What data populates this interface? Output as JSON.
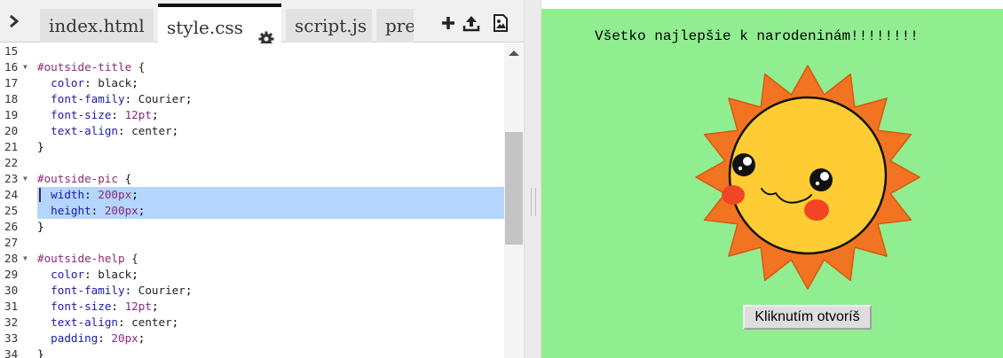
{
  "tabs": [
    {
      "label": "index.html",
      "active": false
    },
    {
      "label": "style.css",
      "active": true
    },
    {
      "label": "script.js",
      "active": false
    },
    {
      "label": "pre",
      "active": false
    }
  ],
  "toolbar": {
    "expand_icon": "chevron-right-icon",
    "settings_icon": "gear-icon",
    "add_icon": "plus-icon",
    "upload_icon": "upload-icon",
    "image_icon": "image-icon"
  },
  "code_lines": [
    {
      "num": "15",
      "text": ""
    },
    {
      "num": "16",
      "text": "#outside-title {"
    },
    {
      "num": "17",
      "text": "  color: black;"
    },
    {
      "num": "18",
      "text": "  font-family: Courier;"
    },
    {
      "num": "19",
      "text": "  font-size: 12pt;"
    },
    {
      "num": "20",
      "text": "  text-align: center;"
    },
    {
      "num": "21",
      "text": "}"
    },
    {
      "num": "22",
      "text": ""
    },
    {
      "num": "23",
      "text": "#outside-pic {"
    },
    {
      "num": "24",
      "text": "  width: 200px;"
    },
    {
      "num": "25",
      "text": "  height: 200px;"
    },
    {
      "num": "26",
      "text": "}"
    },
    {
      "num": "27",
      "text": ""
    },
    {
      "num": "28",
      "text": "#outside-help {"
    },
    {
      "num": "29",
      "text": "  color: black;"
    },
    {
      "num": "30",
      "text": "  font-family: Courier;"
    },
    {
      "num": "31",
      "text": "  font-size: 12pt;"
    },
    {
      "num": "32",
      "text": "  text-align: center;"
    },
    {
      "num": "33",
      "text": "  padding: 20px;"
    },
    {
      "num": "34",
      "text": "}"
    }
  ],
  "preview": {
    "title": "Všetko najlepšie k narodeninám!!!!!!!!",
    "image": "smiling-sun",
    "button_label": "Kliknutím otvoríš",
    "background": "#90ee90"
  },
  "colors": {
    "selection": "#b4d5fe",
    "sun_rays": "#f27321",
    "sun_face": "#ffcd33",
    "cheeks": "#f14526"
  }
}
